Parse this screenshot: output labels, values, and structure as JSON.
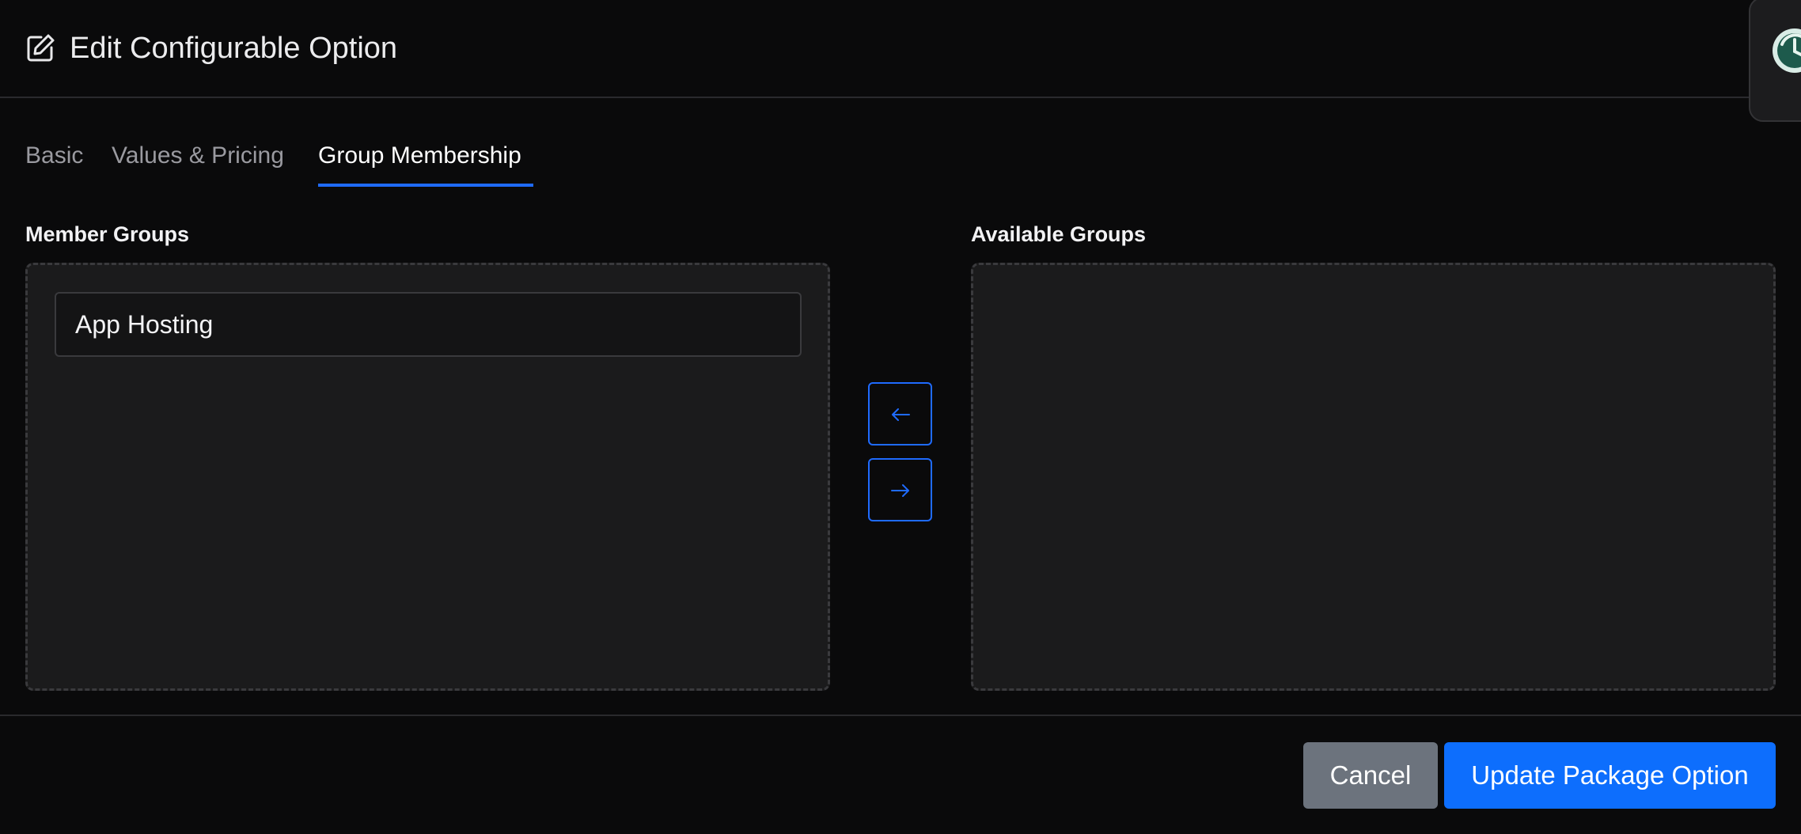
{
  "header": {
    "title": "Edit Configurable Option",
    "icon": "edit-icon"
  },
  "tabs": [
    {
      "label": "Basic",
      "active": false
    },
    {
      "label": "Values & Pricing",
      "active": false
    },
    {
      "label": "Group Membership",
      "active": true
    }
  ],
  "member_groups": {
    "label": "Member Groups",
    "items": [
      "App Hosting"
    ]
  },
  "available_groups": {
    "label": "Available Groups",
    "items": []
  },
  "transfer": {
    "move_left_icon": "arrow-left-icon",
    "move_right_icon": "arrow-right-icon"
  },
  "footer": {
    "cancel_label": "Cancel",
    "submit_label": "Update Package Option"
  },
  "colors": {
    "accent": "#0d6efd",
    "secondary": "#6c737d",
    "background": "#0a0a0b",
    "panel": "#1b1b1c"
  }
}
